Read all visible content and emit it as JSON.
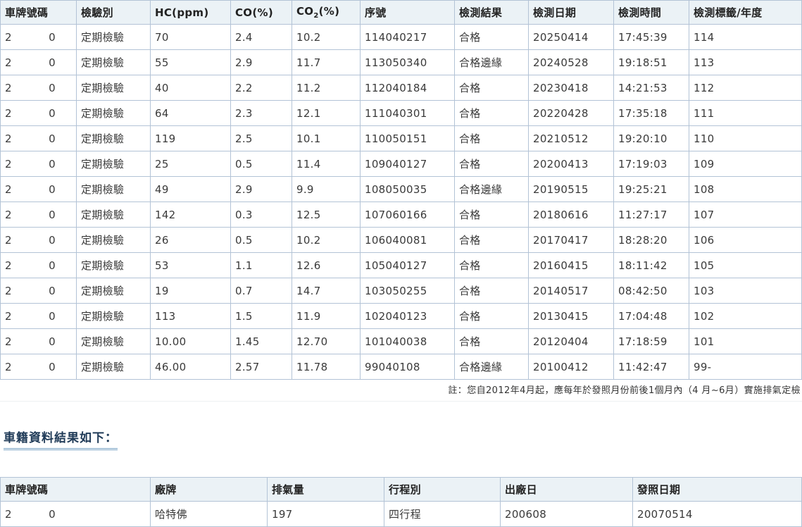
{
  "test_table": {
    "headers": {
      "plate": "車牌號碼",
      "type": "檢驗別",
      "hc": "HC(ppm)",
      "co": "CO(%)",
      "co2_main": "CO",
      "co2_sub": "2",
      "co2_unit": "(%)",
      "serial": "序號",
      "result": "檢測結果",
      "date": "檢測日期",
      "time": "檢測時間",
      "tag": "檢測標籤/年度"
    },
    "rows": [
      {
        "plate_first": "2",
        "plate_last": "0",
        "type": "定期檢驗",
        "hc": "70",
        "co": "2.4",
        "co2": "10.2",
        "serial": "114040217",
        "result": "合格",
        "date": "20250414",
        "time": "17:45:39",
        "tag": "114"
      },
      {
        "plate_first": "2",
        "plate_last": "0",
        "type": "定期檢驗",
        "hc": "55",
        "co": "2.9",
        "co2": "11.7",
        "serial": "113050340",
        "result": "合格邊緣",
        "date": "20240528",
        "time": "19:18:51",
        "tag": "113"
      },
      {
        "plate_first": "2",
        "plate_last": "0",
        "type": "定期檢驗",
        "hc": "40",
        "co": "2.2",
        "co2": "11.2",
        "serial": "112040184",
        "result": "合格",
        "date": "20230418",
        "time": "14:21:53",
        "tag": "112"
      },
      {
        "plate_first": "2",
        "plate_last": "0",
        "type": "定期檢驗",
        "hc": "64",
        "co": "2.3",
        "co2": "12.1",
        "serial": "111040301",
        "result": "合格",
        "date": "20220428",
        "time": "17:35:18",
        "tag": "111"
      },
      {
        "plate_first": "2",
        "plate_last": "0",
        "type": "定期檢驗",
        "hc": "119",
        "co": "2.5",
        "co2": "10.1",
        "serial": "110050151",
        "result": "合格",
        "date": "20210512",
        "time": "19:20:10",
        "tag": "110"
      },
      {
        "plate_first": "2",
        "plate_last": "0",
        "type": "定期檢驗",
        "hc": "25",
        "co": "0.5",
        "co2": "11.4",
        "serial": "109040127",
        "result": "合格",
        "date": "20200413",
        "time": "17:19:03",
        "tag": "109"
      },
      {
        "plate_first": "2",
        "plate_last": "0",
        "type": "定期檢驗",
        "hc": "49",
        "co": "2.9",
        "co2": "9.9",
        "serial": "108050035",
        "result": "合格邊緣",
        "date": "20190515",
        "time": "19:25:21",
        "tag": "108"
      },
      {
        "plate_first": "2",
        "plate_last": "0",
        "type": "定期檢驗",
        "hc": "142",
        "co": "0.3",
        "co2": "12.5",
        "serial": "107060166",
        "result": "合格",
        "date": "20180616",
        "time": "11:27:17",
        "tag": "107"
      },
      {
        "plate_first": "2",
        "plate_last": "0",
        "type": "定期檢驗",
        "hc": "26",
        "co": "0.5",
        "co2": "10.2",
        "serial": "106040081",
        "result": "合格",
        "date": "20170417",
        "time": "18:28:20",
        "tag": "106"
      },
      {
        "plate_first": "2",
        "plate_last": "0",
        "type": "定期檢驗",
        "hc": "53",
        "co": "1.1",
        "co2": "12.6",
        "serial": "105040127",
        "result": "合格",
        "date": "20160415",
        "time": "18:11:42",
        "tag": "105"
      },
      {
        "plate_first": "2",
        "plate_last": "0",
        "type": "定期檢驗",
        "hc": "19",
        "co": "0.7",
        "co2": "14.7",
        "serial": "103050255",
        "result": "合格",
        "date": "20140517",
        "time": "08:42:50",
        "tag": "103"
      },
      {
        "plate_first": "2",
        "plate_last": "0",
        "type": "定期檢驗",
        "hc": "113",
        "co": "1.5",
        "co2": "11.9",
        "serial": "102040123",
        "result": "合格",
        "date": "20130415",
        "time": "17:04:48",
        "tag": "102"
      },
      {
        "plate_first": "2",
        "plate_last": "0",
        "type": "定期檢驗",
        "hc": "10.00",
        "co": "1.45",
        "co2": "12.70",
        "serial": "101040038",
        "result": "合格",
        "date": "20120404",
        "time": "17:18:59",
        "tag": "101"
      },
      {
        "plate_first": "2",
        "plate_last": "0",
        "type": "定期檢驗",
        "hc": "46.00",
        "co": "2.57",
        "co2": "11.78",
        "serial": "99040108",
        "result": "合格邊緣",
        "date": "20100412",
        "time": "11:42:47",
        "tag": "99-"
      }
    ]
  },
  "note": "註：您自2012年4月起，應每年於發照月份前後1個月內（4 月~6月）實施排氣定檢",
  "vehicle_section": {
    "title": "車籍資料結果如下：",
    "headers": {
      "plate": "車牌號碼",
      "brand": "廠牌",
      "displacement": "排氣量",
      "stroke": "行程別",
      "manufacture": "出廠日",
      "license_date": "發照日期"
    },
    "row": {
      "plate_first": "2",
      "plate_last": "0",
      "brand": "哈特佛",
      "displacement": "197",
      "stroke": "四行程",
      "manufacture": "200608",
      "license_date": "20070514"
    }
  }
}
